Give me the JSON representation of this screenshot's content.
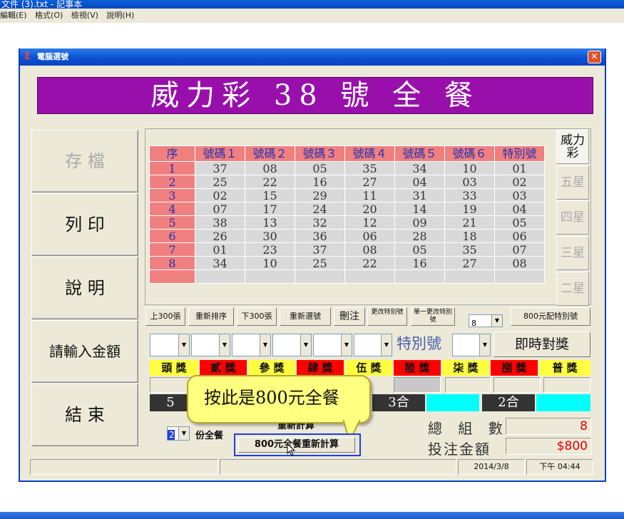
{
  "notepad": {
    "title": "文件 (3).txt - 記事本",
    "menu": [
      "編輯(E)",
      "格式(O)",
      "檢視(V)",
      "說明(H)"
    ]
  },
  "dialog": {
    "title": "電腦選號",
    "close": "✕",
    "banner": "威力彩 38 號 全 餐"
  },
  "left_buttons": [
    "存 檔",
    "列 印",
    "說 明",
    "請輸入金額",
    "結 束"
  ],
  "table": {
    "headers": [
      "序",
      "號碼１",
      "號碼２",
      "號碼３",
      "號碼４",
      "號碼５",
      "號碼６",
      "特別號"
    ],
    "rows": [
      [
        "1",
        "37",
        "08",
        "05",
        "35",
        "34",
        "10",
        "01"
      ],
      [
        "2",
        "25",
        "22",
        "16",
        "27",
        "04",
        "03",
        "02"
      ],
      [
        "3",
        "02",
        "15",
        "29",
        "11",
        "31",
        "33",
        "03"
      ],
      [
        "4",
        "07",
        "17",
        "24",
        "20",
        "14",
        "19",
        "04"
      ],
      [
        "5",
        "38",
        "13",
        "32",
        "12",
        "09",
        "21",
        "05"
      ],
      [
        "6",
        "26",
        "30",
        "36",
        "06",
        "28",
        "18",
        "06"
      ],
      [
        "7",
        "01",
        "23",
        "37",
        "08",
        "05",
        "35",
        "07"
      ],
      [
        "8",
        "34",
        "10",
        "25",
        "22",
        "16",
        "27",
        "08"
      ],
      [
        "",
        "",
        "",
        "",
        "",
        "",
        "",
        ""
      ]
    ]
  },
  "right_tabs": [
    "威力彩",
    "五星",
    "四星",
    "三星",
    "二星"
  ],
  "toolbar": {
    "prev300": "上300張",
    "resort": "重新排序",
    "next300": "下300張",
    "reselect": "重新選號",
    "delete": "刪注",
    "change_special": "更改特別號",
    "change_single": "單一更改特別號",
    "count_select": "8",
    "special800": "800元配特別號"
  },
  "check": {
    "special_label": "特別號",
    "instant": "即時對獎"
  },
  "prizes": [
    "頭 獎",
    "貳 獎",
    "參 獎",
    "肆 獎",
    "伍 獎",
    "陸 獎",
    "柒 獎",
    "捌 獎",
    "普 獎"
  ],
  "hits": [
    "5",
    "3合",
    "2合"
  ],
  "bottom": {
    "portion_value": "2",
    "portion_label": "份全餐",
    "recalc_label": "重新計算",
    "recalc800_label": "800元全餐重新計算",
    "total_groups_label": "總 組 數",
    "total_groups_value": "8",
    "total_amount_label": "投注金額",
    "total_amount_value": "$800"
  },
  "callout": "按此是800元全餐",
  "status": {
    "date": "2014/3/8",
    "time": "下午 04:44"
  }
}
